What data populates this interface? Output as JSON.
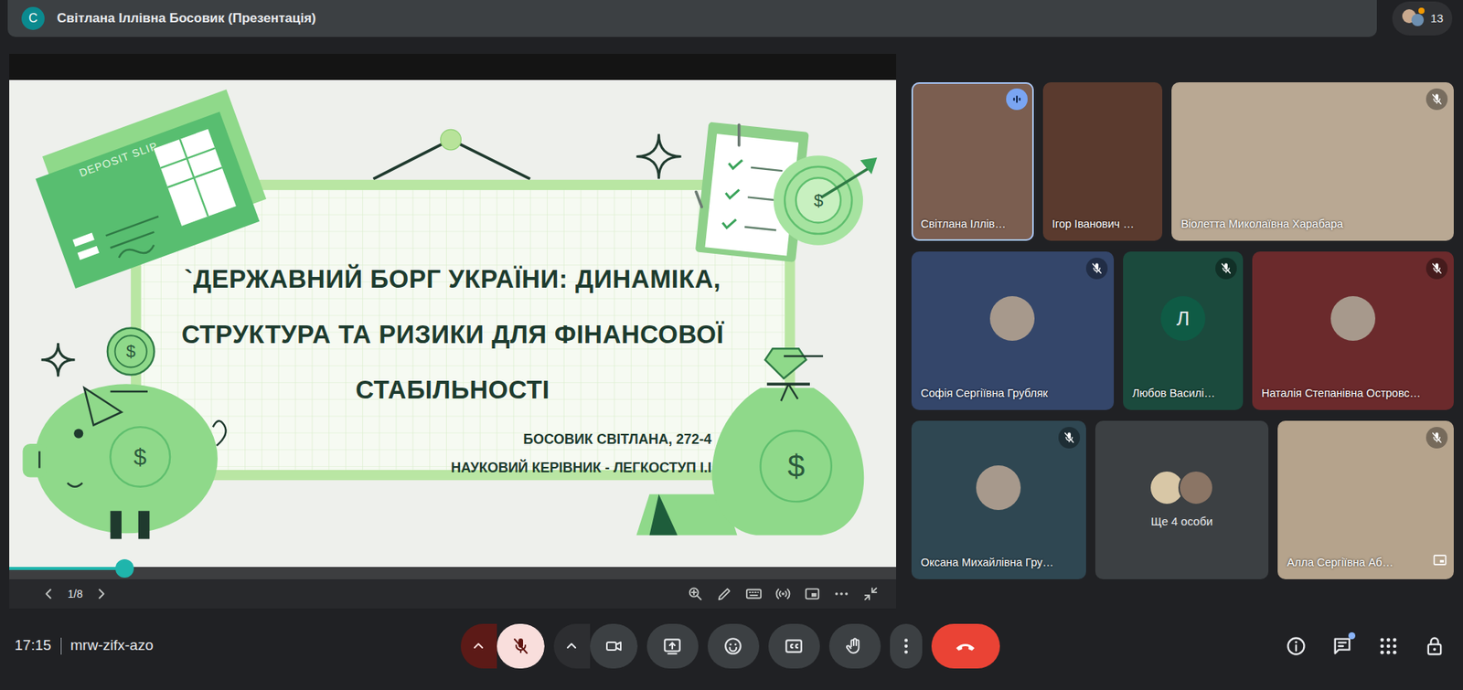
{
  "window": {
    "title": "Світлана Іллівна Босовик (Презентація)",
    "avatar_letter": "С"
  },
  "participants": {
    "count": "13",
    "notification": true
  },
  "presentation": {
    "slide": {
      "title_lines": [
        "`ДЕРЖАВНИЙ БОРГ УКРАЇНИ: ДИНАМІКА,",
        "СТРУКТУРА ТА РИЗИКИ ДЛЯ ФІНАНСОВОЇ",
        "СТАБІЛЬНОСТІ"
      ],
      "author": "БОСОВИК СВІТЛАНА, 272-4",
      "supervisor": "НАУКОВИЙ КЕРІВНИК - ЛЕГКОСТУП І.І",
      "deposit_slip": "DEPOSIT SLIP",
      "currency_sign": "$"
    },
    "progress": {
      "level": 0.13
    },
    "page": "1/8"
  },
  "tile_rows": [
    [
      {
        "name": "Світлана Іллів…",
        "kind": "video",
        "muted": false,
        "speaking": true,
        "self_view": false,
        "color": "#7b5e50"
      },
      {
        "name": "Ігор Іванович …",
        "kind": "video",
        "muted": false,
        "speaking": false,
        "self_view": false,
        "color": "#5a3a2e"
      },
      {
        "name": "Віолетта Миколаївна Харабара",
        "kind": "video",
        "muted": true,
        "speaking": false,
        "self_view": false,
        "color": "#b9a893"
      }
    ],
    [
      {
        "name": "Софія Сергіївна Грубляк",
        "kind": "photo",
        "muted": true,
        "speaking": false,
        "self_view": false,
        "color": "#34466a"
      },
      {
        "name": "Любов Василі…",
        "kind": "letter",
        "letter": "Л",
        "muted": true,
        "speaking": false,
        "self_view": false,
        "color": "#1b4a3d"
      },
      {
        "name": "Наталія Степанівна Островс…",
        "kind": "photo",
        "muted": true,
        "speaking": false,
        "self_view": false,
        "color": "#6b2a2c"
      }
    ],
    [
      {
        "name": "Оксана Михайлівна Гру…",
        "kind": "photo",
        "muted": true,
        "speaking": false,
        "self_view": false,
        "color": "#2f4752"
      },
      {
        "name": "Ще 4 особи",
        "kind": "group",
        "muted": false,
        "speaking": false,
        "self_view": false,
        "color": "#3c4043"
      },
      {
        "name": "Алла Сергіївна Аб…",
        "kind": "video",
        "muted": true,
        "speaking": false,
        "self_view": true,
        "color": "#b5a38c"
      }
    ]
  ],
  "meeting": {
    "time": "17:15",
    "code": "mrw-zifx-azo"
  },
  "controls": {
    "mic_muted": true,
    "chat_unread": true
  }
}
